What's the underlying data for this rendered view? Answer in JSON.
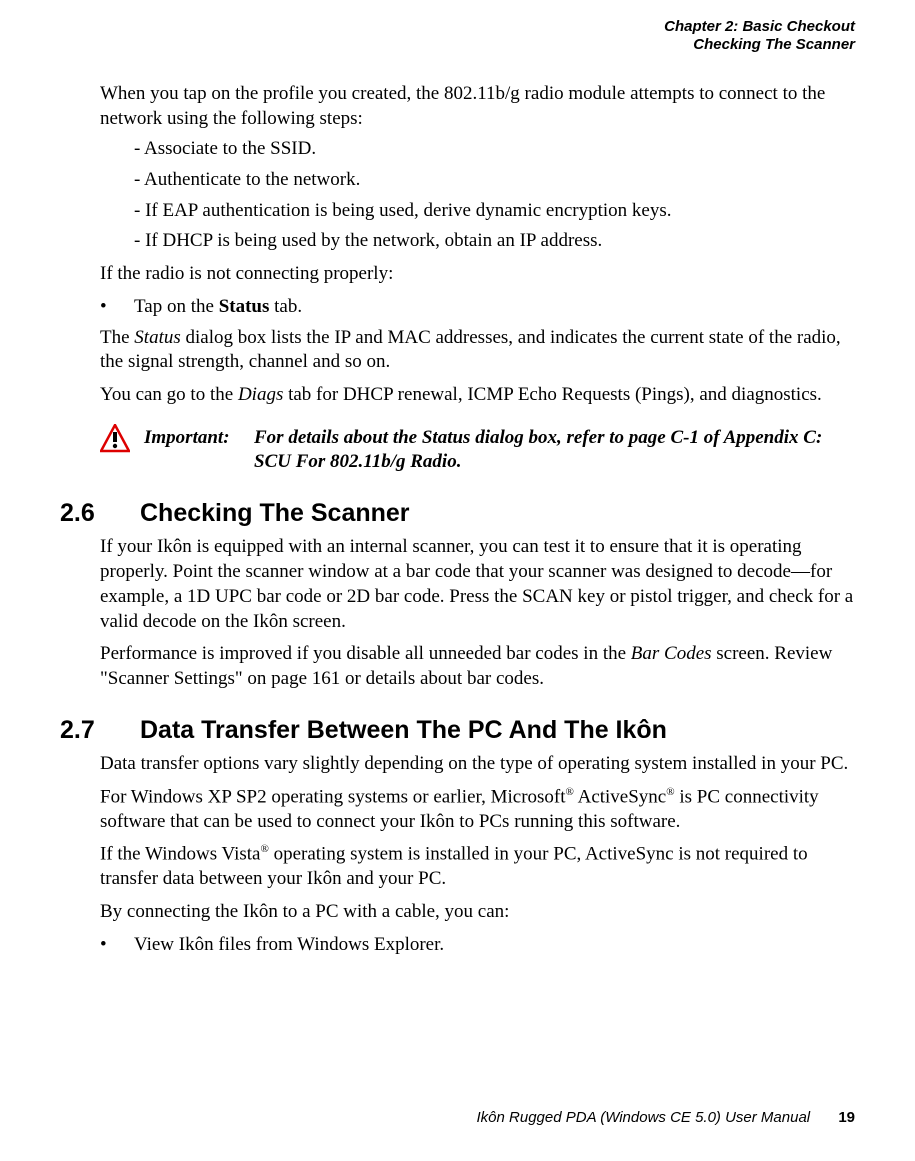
{
  "header": {
    "line1": "Chapter 2: Basic Checkout",
    "line2": "Checking The Scanner"
  },
  "paragraphs": {
    "intro": "When you tap on the profile you created, the 802.11b/g radio module attempts to connect to the network using the following steps:",
    "steps": [
      "- Associate to the SSID.",
      "- Authenticate to the network.",
      "- If EAP authentication is being used, derive dynamic encryption keys.",
      "- If DHCP is being used by the network, obtain an IP address."
    ],
    "not_connecting": "If the radio is not connecting properly:",
    "bullet_dot": "•",
    "bullet_status_pre": "Tap on the ",
    "bullet_status_bold": "Status",
    "bullet_status_post": " tab.",
    "status_para_pre": "The ",
    "status_word": "Status",
    "status_para_post": " dialog box lists the IP and MAC addresses, and indicates the current state of the radio, the signal strength, channel and so on.",
    "diags_pre": "You can go to the ",
    "diags_word": "Diags",
    "diags_post": " tab for DHCP renewal, ICMP Echo Requests (Pings), and diagnostics."
  },
  "important": {
    "label": "Important:",
    "text": "For details about the Status dialog box, refer to page C-1 of Appendix C: SCU For 802.11b/g Radio."
  },
  "section26": {
    "num": "2.6",
    "title": "Checking The Scanner",
    "p1": "If your Ikôn is equipped with an internal scanner, you can test it to ensure that it is operating properly. Point the scanner window at a bar code that your scanner was designed to decode—for example, a 1D UPC bar code or 2D bar code. Press the SCAN key or pistol trigger, and check for a valid decode on the Ikôn screen.",
    "p2_pre": "Performance is improved if you disable all unneeded bar codes in the ",
    "p2_ital": "Bar Codes",
    "p2_post": " screen. Review \"Scanner Settings\" on page 161 or details about bar codes."
  },
  "section27": {
    "num": "2.7",
    "title": "Data Transfer Between The PC And The Ikôn",
    "p1": "Data transfer options vary slightly depending on the type of operating system installed in your PC.",
    "p2_a": "For Windows XP SP2 operating systems or earlier, Microsoft",
    "p2_b": " ActiveSync",
    "p2_c": " is PC connectivity software that can be used to connect your Ikôn to PCs running this software.",
    "p3_a": "If the Windows Vista",
    "p3_b": " operating system is installed in your PC, ActiveSync is not required to transfer data between your Ikôn and your PC.",
    "p4": "By connecting the Ikôn to a PC with a cable, you can:",
    "bullet_dot": "•",
    "bullet1": "View Ikôn files from Windows Explorer."
  },
  "reg": "®",
  "footer": {
    "title": "Ikôn Rugged PDA (Windows CE 5.0) User Manual",
    "page": "19"
  }
}
